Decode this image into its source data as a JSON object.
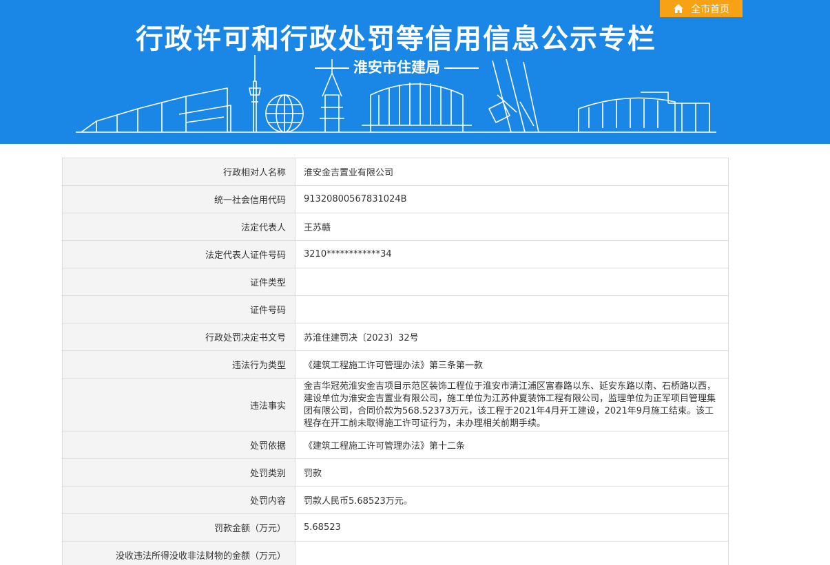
{
  "header": {
    "title": "行政许可和行政处罚等信用信息公示专栏",
    "subtitle": "淮安市住建局",
    "home_button": "全市首页",
    "home_icon": "home-icon"
  },
  "colors": {
    "banner_bg": "#1a87e6",
    "home_button_bg": "#f6a214",
    "label_bg": "#f4f4f4",
    "border": "#dcdcdc"
  },
  "rows": [
    {
      "label": "行政相对人名称",
      "value": "淮安金吉置业有限公司"
    },
    {
      "label": "统一社会信用代码",
      "value": "91320800567831024B"
    },
    {
      "label": "法定代表人",
      "value": "王苏赣"
    },
    {
      "label": "法定代表人证件号码",
      "value": "3210************34"
    },
    {
      "label": "证件类型",
      "value": ""
    },
    {
      "label": "证件号码",
      "value": ""
    },
    {
      "label": "行政处罚决定书文号",
      "value": "苏淮住建罚决〔2023〕32号"
    },
    {
      "label": "违法行为类型",
      "value": "《建筑工程施工许可管理办法》第三条第一款"
    },
    {
      "label": "违法事实",
      "value": "金吉华冠苑淮安金吉项目示范区装饰工程位于淮安市清江浦区富春路以东、延安东路以南、石桥路以西，建设单位为淮安金吉置业有限公司，施工单位为江苏仲夏装饰工程有限公司，监理单位为正军项目管理集团有限公司，合同价款为568.52373万元，该工程于2021年4月开工建设，2021年9月施工结束。该工程存在开工前未取得施工许可证行为，未办理相关前期手续。"
    },
    {
      "label": "处罚依据",
      "value": "《建筑工程施工许可管理办法》第十二条"
    },
    {
      "label": "处罚类别",
      "value": "罚款"
    },
    {
      "label": "处罚内容",
      "value": "罚款人民币5.68523万元。"
    },
    {
      "label": "罚款金额（万元）",
      "value": "5.68523"
    },
    {
      "label": "没收违法所得没收非法财物的金额（万元）",
      "value": ""
    }
  ]
}
